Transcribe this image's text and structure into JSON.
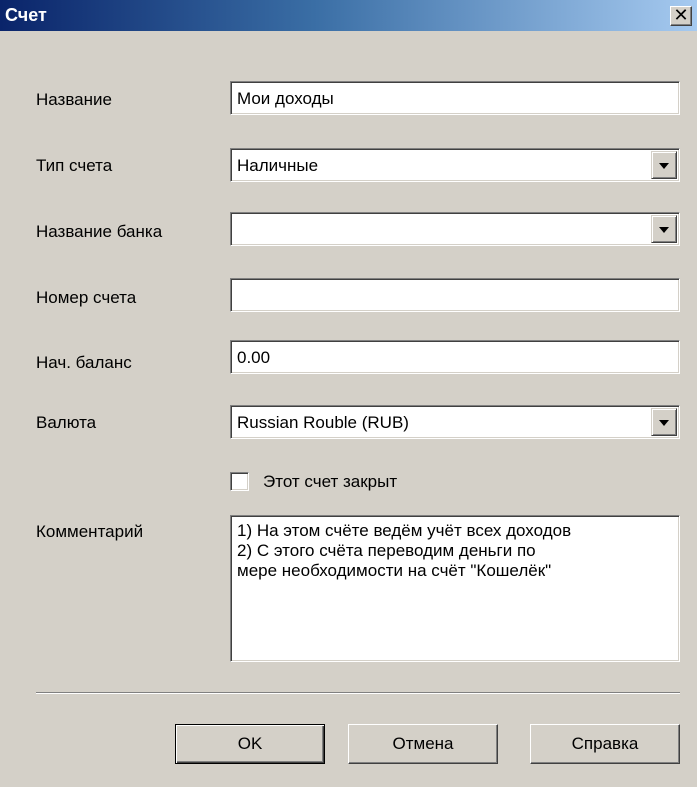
{
  "window": {
    "title": "Счет",
    "close_glyph": "✕"
  },
  "form": {
    "name_label": "Название",
    "name_value": "Мои доходы",
    "type_label": "Тип счета",
    "type_value": "Наличные",
    "bank_label": "Название банка",
    "bank_value": "",
    "number_label": "Номер счета",
    "number_value": "",
    "balance_label": "Нач. баланс",
    "balance_value": "0.00",
    "currency_label": "Валюта",
    "currency_value": "Russian Rouble (RUB)",
    "closed_label": "Этот счет закрыт",
    "closed_checked": false,
    "comment_label": "Комментарий",
    "comment_lines": [
      "1) На этом счёте ведём учёт всех доходов",
      "2) С этого счёта переводим деньги по",
      "мере необходимости на счёт \"Кошелёк\""
    ]
  },
  "buttons": {
    "ok_label": "OK",
    "cancel_label": "Отмена",
    "help_label": "Справка"
  },
  "icons": {
    "close": "close-icon",
    "dropdown": "chevron-down-icon"
  },
  "colors": {
    "dialog_bg": "#d4d0c8",
    "title_start": "#0a246a",
    "title_end": "#a6caf0"
  }
}
